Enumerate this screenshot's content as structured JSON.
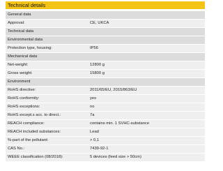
{
  "title": "Technical details",
  "rows": [
    {
      "type": "section",
      "label": "General data"
    },
    {
      "type": "item",
      "label": "Approval:",
      "value": "CE, UKCA"
    },
    {
      "type": "section",
      "label": "Technical data"
    },
    {
      "type": "section",
      "label": "Environmental data"
    },
    {
      "type": "item",
      "label": "Protection type, housing:",
      "value": "IP56"
    },
    {
      "type": "section",
      "label": "Mechanical data"
    },
    {
      "type": "item",
      "label": "Net-weight:",
      "value": "12800 g"
    },
    {
      "type": "item",
      "label": "Gross weight:",
      "value": "15800 g"
    },
    {
      "type": "section",
      "label": "Environment"
    },
    {
      "type": "item",
      "label": "RoHS directive:",
      "value": "2011/65/EU, 2015/863/EU"
    },
    {
      "type": "item",
      "label": "RoHS conformity:",
      "value": "yes"
    },
    {
      "type": "item",
      "label": "RoHS exceptions:",
      "value": "no"
    },
    {
      "type": "item",
      "label": "RoHS except.s acc. to direct.:",
      "value": "7a"
    },
    {
      "type": "item",
      "label": "REACH compliance:",
      "value": "contains min. 1 SVHC-substance"
    },
    {
      "type": "item",
      "label": "REACH included substances:",
      "value": "Lead"
    },
    {
      "type": "item",
      "label": "%-part of the pollutant:",
      "value": "> 0,1"
    },
    {
      "type": "item",
      "label": "CAS No.:",
      "value": "7439-92-1"
    },
    {
      "type": "item",
      "label": "WEEE classification (08/2018):",
      "value": "5 devices (feed size > 50cm)"
    }
  ]
}
